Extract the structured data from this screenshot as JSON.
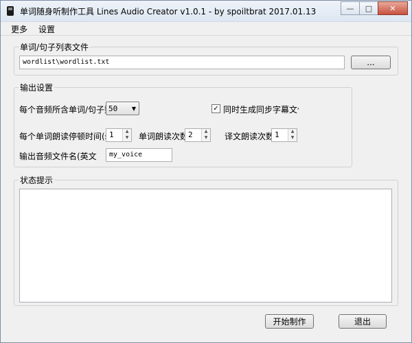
{
  "window": {
    "title": "单词随身听制作工具  Lines Audio Creator v1.0.1 - by spoiltbrat  2017.01.13"
  },
  "caption_buttons": {
    "minimize": "—",
    "maximize": "□",
    "close": "✕"
  },
  "menu": {
    "items": [
      "更多",
      "设置"
    ]
  },
  "file_group": {
    "legend": "单词/句子列表文件",
    "path_value": "wordlist\\wordlist.txt",
    "browse_label": "..."
  },
  "output_group": {
    "legend": "输出设置",
    "words_per_audio_label": "每个音频所含单词/句子数",
    "words_per_audio_value": "50",
    "subtitle_checkbox_label": "同时生成同步字幕文件",
    "subtitle_checked": "✓",
    "pause_label": "每个单词朗读停顿时间(s",
    "pause_value": "1",
    "word_repeat_label": "单词朗读次数",
    "word_repeat_value": "2",
    "translation_repeat_label": "译文朗读次数",
    "translation_repeat_value": "1",
    "filename_label": "输出音频文件名(英文",
    "filename_value": "my_voice"
  },
  "status_group": {
    "legend": "状态提示",
    "content": ""
  },
  "actions": {
    "start_label": "开始制作",
    "exit_label": "退出"
  }
}
